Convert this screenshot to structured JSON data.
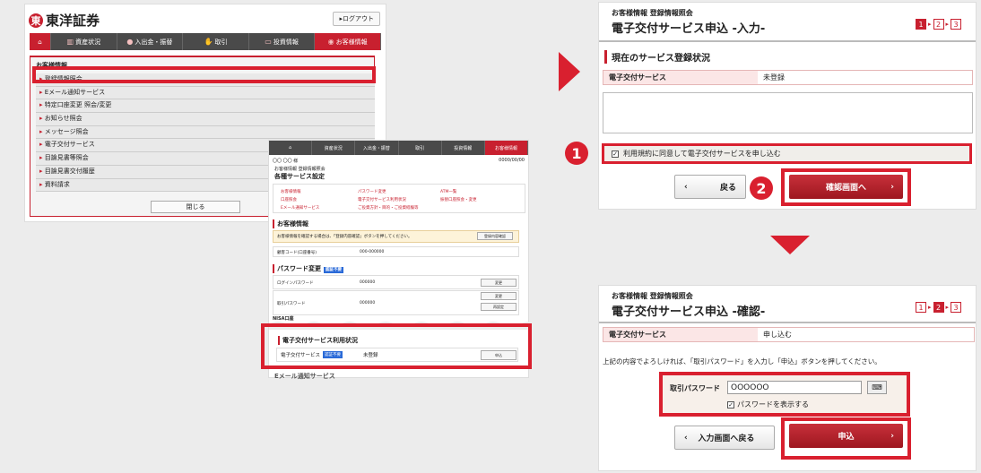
{
  "colors": {
    "accent": "#c8202f",
    "highlight": "#d9202f",
    "nav_bg": "#4a4a4a"
  },
  "brand": {
    "logo_mark": "東",
    "name": "東洋証券"
  },
  "header": {
    "logout": "ログアウト"
  },
  "nav": {
    "items": [
      {
        "label": "",
        "icon": "home-icon"
      },
      {
        "label": "資産状況",
        "icon": "chart-icon"
      },
      {
        "label": "入出金・振替",
        "icon": "coins-icon"
      },
      {
        "label": "取引",
        "icon": "handshake-icon"
      },
      {
        "label": "投資情報",
        "icon": "monitor-icon"
      },
      {
        "label": "お客様情報",
        "icon": "user-icon"
      }
    ]
  },
  "menu": {
    "title": "お客様情報",
    "items": [
      "登録情報照会",
      "Eメール通知サービス",
      "特定口座変更 照会/変更",
      "お知らせ照会",
      "メッセージ照会",
      "電子交付サービス",
      "目論見書等照会",
      "目論見書交付履歴",
      "資料請求"
    ],
    "close": "閉じる"
  },
  "service_page": {
    "user": "〇〇 〇〇 様",
    "date": "0000/00/00",
    "breadcrumb": "お客様情報 登録情報照会",
    "title": "各種サービス設定",
    "links": [
      "お客様情報",
      "パスワード変更",
      "ATM一覧",
      "口座照会",
      "電子交付サービス利用状況",
      "振替口座照会・変更",
      "Eメール通知サービス",
      "ご投資方針・目的・ご投資経験等"
    ],
    "info_title": "お客様情報",
    "info_note": "お客様情報を確認する場合は、「登録内容確認」ボタンを押してください。",
    "info_btn": "登録内容確認",
    "cust_code_label": "顧客コード(口座番号)",
    "cust_code": "000-000000",
    "pw_title": "パスワード変更",
    "pw_badge": "認証不要",
    "login_pw": "ログインパスワード",
    "trade_pw": "取引パスワード",
    "masked": "000000",
    "change": "変更",
    "reset": "再設定",
    "nisa": "NISA口座",
    "edelivery_title": "電子交付サービス利用状況",
    "edelivery_label": "電子交付サービス",
    "edelivery_badge": "認証不要",
    "edelivery_status": "未登録",
    "apply": "申込",
    "email_cut": "Eメール通知サービス"
  },
  "input_page": {
    "breadcrumb": "お客様情報 登録情報照会",
    "title": "電子交付サービス申込 -入力-",
    "steps": [
      "1",
      "2",
      "3"
    ],
    "current_step": 1,
    "section": "現在のサービス登録状況",
    "row_label": "電子交付サービス",
    "row_value": "未登録",
    "agree_text": "利用規約に同意して電子交付サービスを申し込む",
    "agree_checked": true,
    "back": "戻る",
    "next": "確認画面へ",
    "marker1": "1",
    "marker2": "2"
  },
  "confirm_page": {
    "breadcrumb": "お客様情報 登録情報照会",
    "title": "電子交付サービス申込 -確認-",
    "steps": [
      "1",
      "2",
      "3"
    ],
    "current_step": 2,
    "row_label": "電子交付サービス",
    "row_value": "申し込む",
    "instruction": "上記の内容でよろしければ、「取引パスワード」を入力し「申込」ボタンを押してください。",
    "pw_label": "取引パスワード",
    "pw_value": "OOOOOO",
    "show_pw": "パスワードを表示する",
    "show_pw_checked": true,
    "back": "入力画面へ戻る",
    "submit": "申込"
  }
}
